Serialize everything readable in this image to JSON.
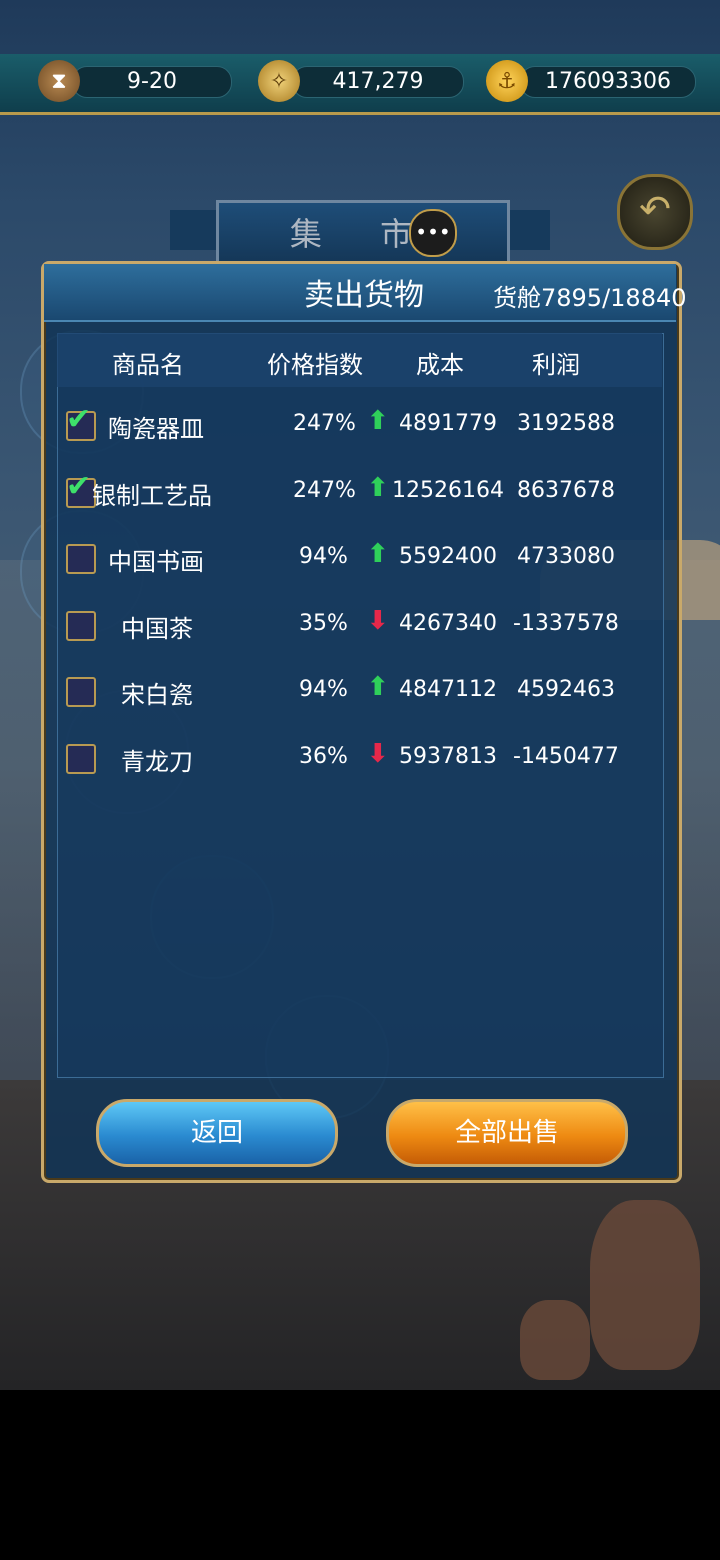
{
  "topbar": {
    "date": "9-20",
    "coins": "417,279",
    "gold": "176093306",
    "icons": [
      "hourglass-icon",
      "compass-icon",
      "anchor-coin-icon"
    ]
  },
  "banner": {
    "title": "集 市"
  },
  "panel": {
    "title": "卖出货物",
    "capacity": "货舱7895/18840"
  },
  "table": {
    "headers": [
      "商品名",
      "价格指数",
      "成本",
      "利润"
    ],
    "rows": [
      {
        "name": "陶瓷器皿",
        "checked": true,
        "price_index": "247%",
        "trend": "up",
        "cost": "4891779",
        "profit": "3192588"
      },
      {
        "name": "银制工艺品",
        "checked": true,
        "price_index": "247%",
        "trend": "up",
        "cost": "12526164",
        "profit": "8637678"
      },
      {
        "name": "中国书画",
        "checked": false,
        "price_index": "94%",
        "trend": "up",
        "cost": "5592400",
        "profit": "4733080"
      },
      {
        "name": "中国茶",
        "checked": false,
        "price_index": "35%",
        "trend": "down",
        "cost": "4267340",
        "profit": "-1337578"
      },
      {
        "name": "宋白瓷",
        "checked": false,
        "price_index": "94%",
        "trend": "up",
        "cost": "4847112",
        "profit": "4592463"
      },
      {
        "name": "青龙刀",
        "checked": false,
        "price_index": "36%",
        "trend": "down",
        "cost": "5937813",
        "profit": "-1450477"
      }
    ]
  },
  "buttons": {
    "back": "返回",
    "sell_all": "全部出售"
  },
  "colors": {
    "trend_up": "#2fd05a",
    "trend_down": "#e6284a",
    "button_back": "#2a8ad0",
    "button_sell": "#ee8a12",
    "frame_gold": "#c9a96a"
  }
}
